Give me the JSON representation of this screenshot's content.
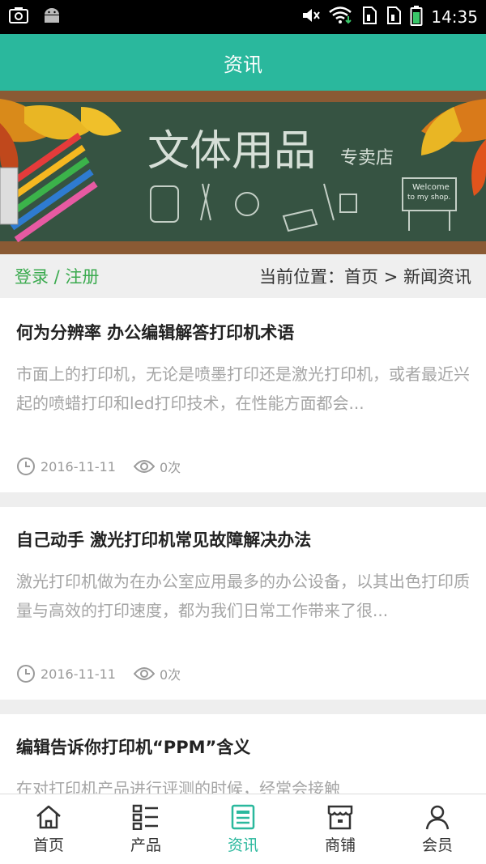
{
  "status_bar": {
    "time": "14:35",
    "icons": [
      "screenshot-icon",
      "android-icon",
      "mute-icon",
      "wifi-icon",
      "sim1-icon",
      "sim2-icon",
      "battery-icon"
    ]
  },
  "header": {
    "title": "资讯"
  },
  "banner": {
    "title": "文体用品",
    "subtitle": "专卖店",
    "board_text_1": "Welcome",
    "board_text_2": "to my shop."
  },
  "location_bar": {
    "login_link": "登录 / 注册",
    "breadcrumb": "当前位置：首页 > 新闻资讯"
  },
  "articles": [
    {
      "title": "何为分辨率 办公编辑解答打印机术语",
      "summary": "市面上的打印机，无论是喷墨打印还是激光打印机，或者最近兴起的喷蜡打印和led打印技术，在性能方面都会...",
      "date": "2016-11-11",
      "views": "0次"
    },
    {
      "title": "自己动手 激光打印机常见故障解决办法",
      "summary": "激光打印机做为在办公室应用最多的办公设备，以其出色打印质量与高效的打印速度，都为我们日常工作带来了很...",
      "date": "2016-11-11",
      "views": "0次"
    },
    {
      "title": "编辑告诉你打印机“PPM”含义",
      "summary": "在对打印机产品进行评测的时候，经常会接触"
    }
  ],
  "tab_bar": {
    "tabs": [
      {
        "label": "首页",
        "icon": "home-icon"
      },
      {
        "label": "产品",
        "icon": "list-icon"
      },
      {
        "label": "资讯",
        "icon": "news-icon",
        "active": true
      },
      {
        "label": "商铺",
        "icon": "shop-icon"
      },
      {
        "label": "会员",
        "icon": "user-icon"
      }
    ]
  },
  "colors": {
    "accent": "#2ab89d",
    "login_green": "#3aaa4e"
  }
}
